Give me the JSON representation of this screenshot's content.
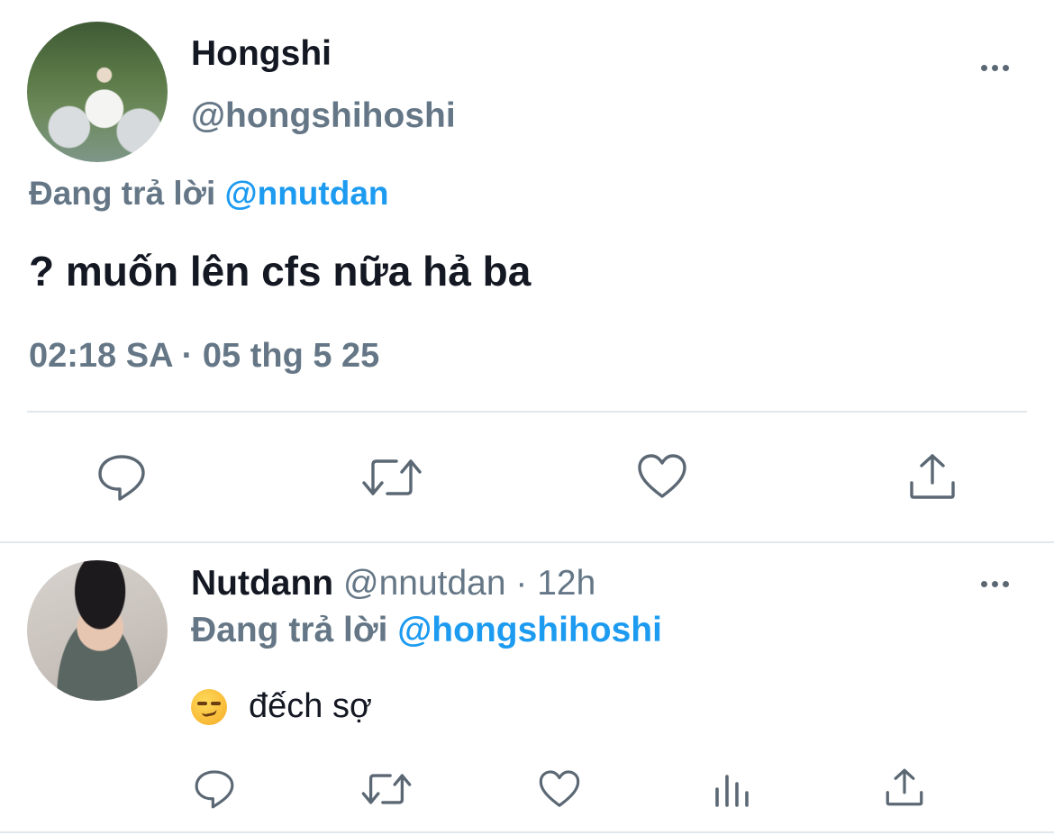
{
  "main_tweet": {
    "display_name": "Hongshi",
    "handle": "@hongshihoshi",
    "replying_prefix": "Đang trả lời",
    "replying_to": "@nnutdan",
    "text": "? muốn lên cfs nữa hả ba",
    "timestamp": "02:18 SA · 05 thg 5 25",
    "actions": [
      "reply-icon",
      "retweet-icon",
      "like-icon",
      "share-icon"
    ]
  },
  "reply_tweet": {
    "display_name": "Nutdann",
    "handle": "@nnutdan",
    "separator": " · ",
    "time_ago": "12h",
    "replying_prefix": "Đang trả lời",
    "replying_to": "@hongshihoshi",
    "emoji": "smirking-face",
    "text": "đếch sợ",
    "actions": [
      "reply-icon",
      "retweet-icon",
      "like-icon",
      "analytics-icon",
      "share-icon"
    ]
  },
  "colors": {
    "text_primary": "#141823",
    "text_secondary": "#657786",
    "accent": "#1d9bf0",
    "icon": "#5b6874",
    "divider": "#e1e8ed"
  }
}
